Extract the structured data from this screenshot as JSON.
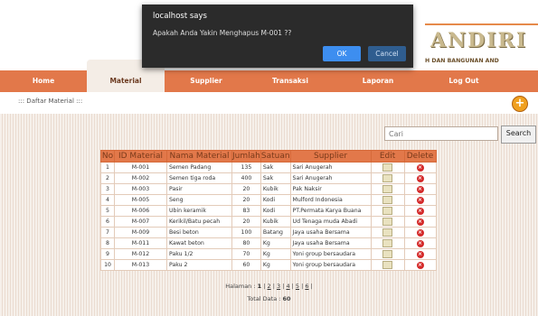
{
  "brand": {
    "word": "ANDIRI",
    "subtitle": "H DAN BANGUNAN AND"
  },
  "nav": {
    "items": [
      {
        "label": "Home"
      },
      {
        "label": "Material"
      },
      {
        "label": "Supplier"
      },
      {
        "label": "Transaksi"
      },
      {
        "label": "Laporan"
      },
      {
        "label": "Log Out"
      }
    ],
    "active": "Material"
  },
  "breadcrumb": "::: Daftar Material :::",
  "search": {
    "placeholder": "Cari",
    "button": "Search"
  },
  "table": {
    "headers": [
      "No",
      "ID Material",
      "Nama Material",
      "Jumlah",
      "Satuan",
      "Supplier",
      "Edit",
      "Delete"
    ],
    "rows": [
      [
        "1",
        "M-001",
        "Semen Padang",
        "135",
        "Sak",
        "Sari Anugerah"
      ],
      [
        "2",
        "M-002",
        "Semen tiga roda",
        "400",
        "Sak",
        "Sari Anugerah"
      ],
      [
        "3",
        "M-003",
        "Pasir",
        "20",
        "Kubik",
        "Pak Naksir"
      ],
      [
        "4",
        "M-005",
        "Seng",
        "20",
        "Kodi",
        "Mulford Indonesia"
      ],
      [
        "5",
        "M-006",
        "Ubin keramik",
        "83",
        "Kodi",
        "PT.Permata Karya Buana"
      ],
      [
        "6",
        "M-007",
        "Kerikil/Batu pecah",
        "20",
        "Kubik",
        "Ud Tenaga muda Abadi"
      ],
      [
        "7",
        "M-009",
        "Besi beton",
        "100",
        "Batang",
        "Jaya usaha Bersama"
      ],
      [
        "8",
        "M-011",
        "Kawat beton",
        "80",
        "Kg",
        "Jaya usaha Bersama"
      ],
      [
        "9",
        "M-012",
        "Paku 1/2",
        "70",
        "Kg",
        "Yoni group bersaudara"
      ],
      [
        "10",
        "M-013",
        "Paku 2",
        "60",
        "Kg",
        "Yoni group bersaudara"
      ]
    ]
  },
  "pagination": {
    "label": "Halaman :",
    "current": "1",
    "pages": [
      "2",
      "3",
      "4",
      "5",
      "6"
    ]
  },
  "total": {
    "label": "Total Data :",
    "value": "60"
  },
  "dialog": {
    "title": "localhost says",
    "message": "Apakah Anda Yakin Menghapus M-001 ??",
    "ok": "OK",
    "cancel": "Cancel"
  },
  "colors": {
    "nav": "#e2784a",
    "accent_blue": "#3d8ef0",
    "delete": "#d42a2a"
  }
}
